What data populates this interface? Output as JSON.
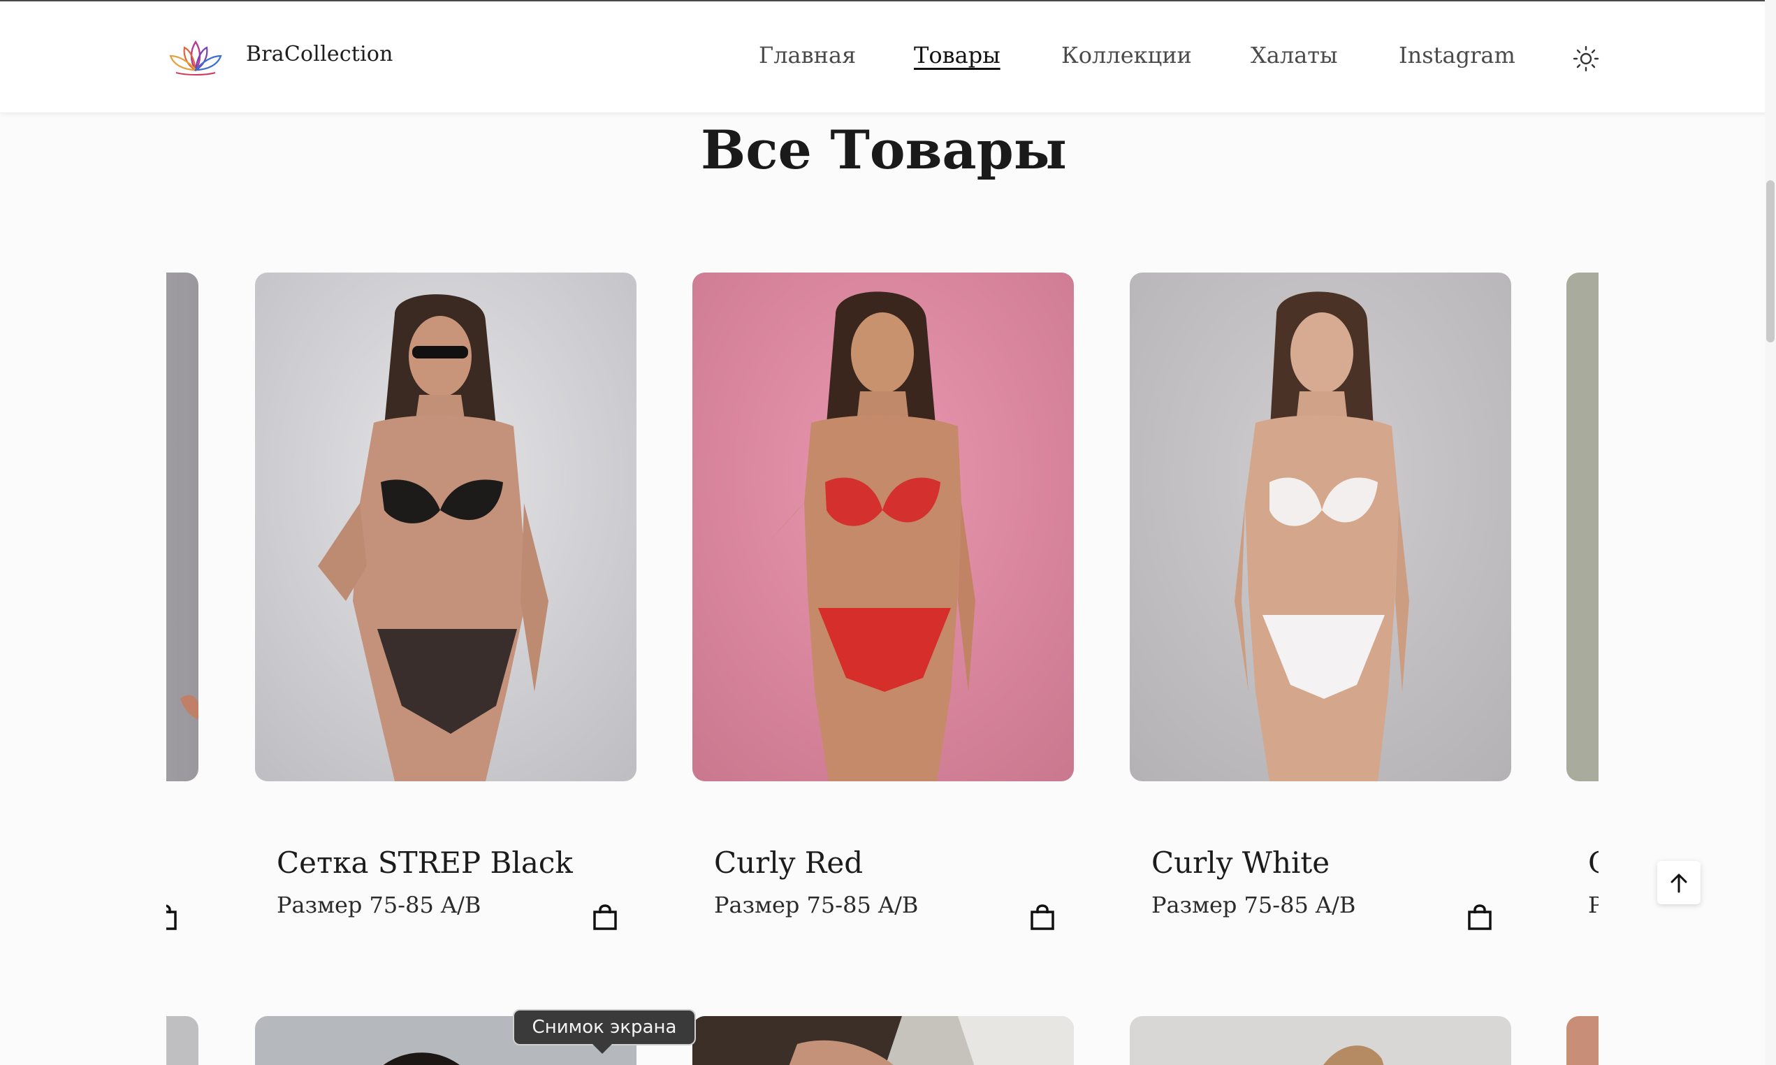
{
  "header": {
    "brand": "BraCollection",
    "nav": [
      {
        "label": "Главная"
      },
      {
        "label": "Товары"
      },
      {
        "label": "Коллекции"
      },
      {
        "label": "Халаты"
      },
      {
        "label": "Instagram"
      }
    ],
    "active_nav": "Товары"
  },
  "page": {
    "title": "Все Товары"
  },
  "products": [
    {
      "name": "Сетка STREP Black",
      "size": "Размер 75-85 A/B",
      "background": "#d3d3d6"
    },
    {
      "name": "Curly Red",
      "size": "Размер 75-85 A/B",
      "background": "#e08aa2"
    },
    {
      "name": "Curly White",
      "size": "Размер 75-85 A/B",
      "background": "#c3c1c3"
    }
  ],
  "partial_products": {
    "left_size_fragment": "",
    "right_name_fragment": "C",
    "right_size_fragment": "P"
  },
  "icons": {
    "cart": "shopping-bag-icon",
    "theme": "sun-icon",
    "back_to_top": "arrow-up-icon"
  },
  "tooltip": {
    "label": "Снимок экрана"
  }
}
